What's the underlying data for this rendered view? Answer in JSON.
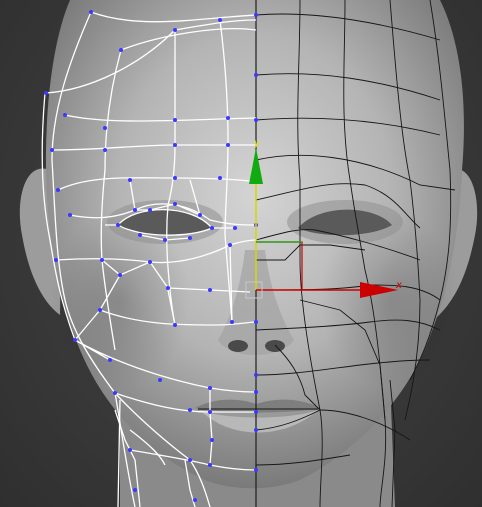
{
  "viewport": {
    "colors": {
      "background": "#3d3d3d",
      "skin_light": "#d2d2d2",
      "skin_mid": "#a9a9a9",
      "skin_dark": "#6e6e6e",
      "wire_selected": "#ffffff",
      "wire_unselected": "#111111",
      "vertex": "#3a3aff",
      "symmetry_line": "#202020"
    }
  },
  "gizmo": {
    "x_label": "x",
    "y_label": "y",
    "x_axis_color": "#cc0000",
    "y_axis_color": "#11aa11",
    "y_line_color": "#e6e600",
    "plane_color": "#cc0000"
  }
}
